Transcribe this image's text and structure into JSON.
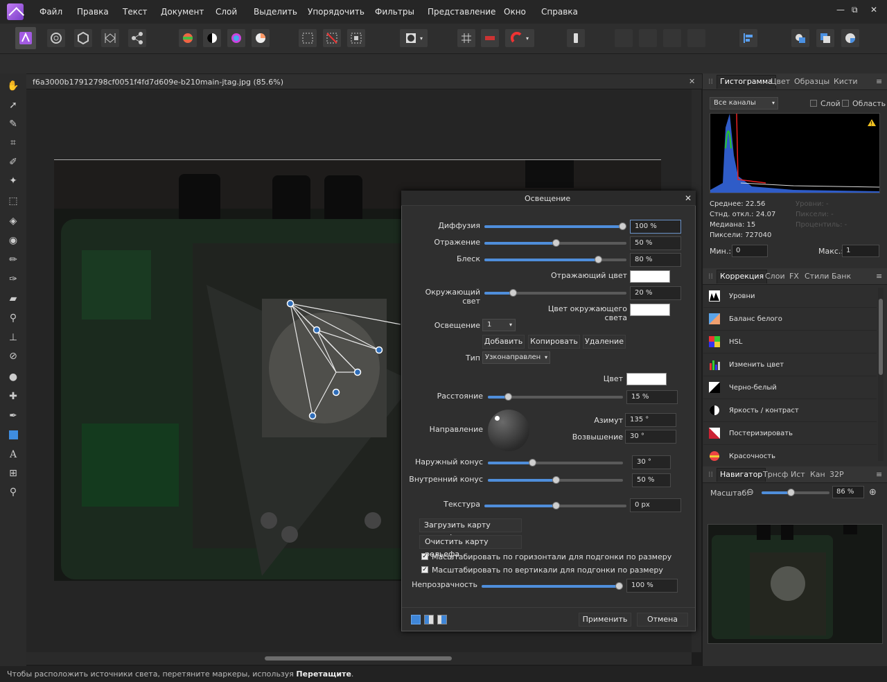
{
  "menubar": {
    "items": [
      "Файл",
      "Правка",
      "Текст",
      "Документ",
      "Слой",
      "Выделить",
      "Упорядочить",
      "Фильтры",
      "Представление",
      "Окно",
      "Справка"
    ],
    "win_minimize": "—",
    "win_restore": "⧉",
    "win_close": "✕"
  },
  "document": {
    "title": "f6a3000b17912798cf0051f4fd7d609e-b210main-jtag.jpg (85.6%)",
    "close": "✕"
  },
  "status": {
    "text": "Чтобы расположить источники света, перетяните маркеры, используя ",
    "bold": "Перетащите",
    "end": "."
  },
  "histogram_panel": {
    "tabs": [
      "Гистограмма",
      "Цвет",
      "Образцы",
      "Кисти"
    ],
    "channel": "Все каналы",
    "layer_label": "Слой",
    "area_label": "Область",
    "mean": "Среднее: 22.56",
    "stddev": "Стнд. откл.: 24.07",
    "median": "Медиана: 15",
    "pixels": "Пиксели: 727040",
    "levels": "Уровни: -",
    "pixels_dim": "Пиксели: -",
    "percentile": "Процентиль: -",
    "min_label": "Мин.:",
    "min_value": "0",
    "max_label": "Макс.:",
    "max_value": "1"
  },
  "adjust_panel": {
    "tabs": [
      "Коррекция",
      "Слои",
      "FX",
      "Стили",
      "Банк"
    ],
    "items": [
      "Уровни",
      "Баланс белого",
      "HSL",
      "Изменить цвет",
      "Черно-белый",
      "Яркость / контраст",
      "Постеризировать",
      "Красочность"
    ]
  },
  "navigator_panel": {
    "tabs": [
      "Навигатор",
      "Трнсф",
      "Ист",
      "Кан",
      "32P"
    ],
    "zoom_label": "Масштаб:",
    "zoom_value": "86 %",
    "zoom_level": 0.86
  },
  "dialog": {
    "title": "Освещение",
    "close": "✕",
    "diffusion_label": "Диффузия",
    "diffusion": "100 %",
    "diffusion_pct": 1.0,
    "reflection_label": "Отражение",
    "reflection": "50 %",
    "reflection_pct": 0.5,
    "gloss_label": "Блеск",
    "gloss": "80 %",
    "gloss_pct": 0.8,
    "refl_color_label": "Отражающий цвет",
    "ambient_label": "Окружающий свет",
    "ambient": "20 %",
    "ambient_pct": 0.2,
    "ambient_color_label": "Цвет окружающего света",
    "lighting_label": "Освещение",
    "lighting_value": "1",
    "add": "Добавить",
    "copy": "Копировать",
    "delete": "Удаление",
    "type_label": "Тип",
    "type_value": "Узконаправлен",
    "color_label": "Цвет",
    "distance_label": "Расстояние",
    "distance": "15 %",
    "distance_pct": 0.15,
    "direction_label": "Направление",
    "azimuth_label": "Азимут",
    "azimuth": "135 °",
    "elevation_label": "Возвышение",
    "elevation": "30 °",
    "outer_label": "Наружный конус",
    "outer": "30 °",
    "outer_pct": 0.33,
    "inner_label": "Внутренний конус",
    "inner": "50 %",
    "inner_pct": 0.5,
    "texture_label": "Текстура",
    "texture": "0 px",
    "texture_pct": 0.5,
    "load_bump": "Загрузить карту рельефа",
    "clear_bump": "Очистить карту рельефа",
    "scale_h": "Масштабировать по горизонтали для подгонки по размеру",
    "scale_v": "Масштабировать по вертикали для подгонки по размеру",
    "opacity_label": "Непрозрачность",
    "opacity": "100 %",
    "opacity_pct": 1.0,
    "apply": "Применить",
    "cancel": "Отмена"
  }
}
